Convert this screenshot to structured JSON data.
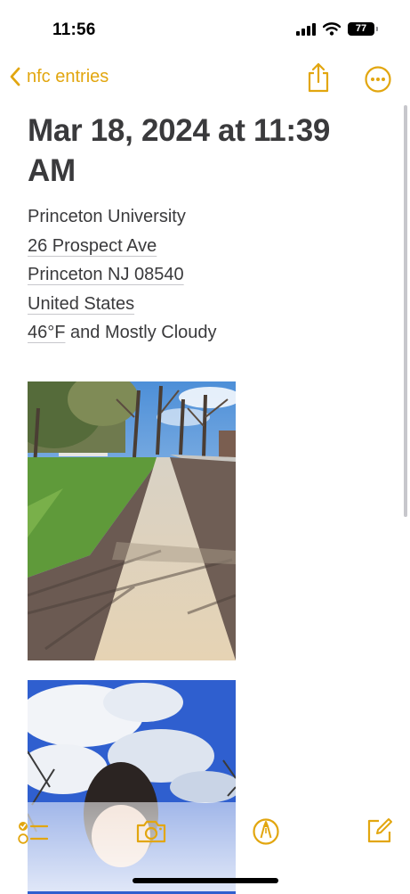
{
  "status_bar": {
    "time": "11:56",
    "battery": "77",
    "icons": [
      "cellular-signal-icon",
      "wifi-icon",
      "battery-icon"
    ]
  },
  "nav": {
    "back_label": "nfc entries",
    "icons": [
      "chevron-left-icon",
      "share-icon",
      "more-icon"
    ]
  },
  "note": {
    "title": "Mar 18, 2024 at 11:39 AM",
    "organization": "Princeton University",
    "address_street": "26 Prospect Ave",
    "address_city": "Princeton NJ 08540",
    "address_country": "United States",
    "temperature": "46°F",
    "weather": " and Mostly Cloudy",
    "photos": [
      "sidewalk-photo",
      "selfie-sky-photo"
    ]
  },
  "toolbar": {
    "icons": [
      "checklist-icon",
      "camera-icon",
      "markup-pen-icon",
      "compose-icon"
    ]
  },
  "colors": {
    "accent": "#e2a60f",
    "text": "#3a3a3c",
    "background": "#ffffff"
  }
}
